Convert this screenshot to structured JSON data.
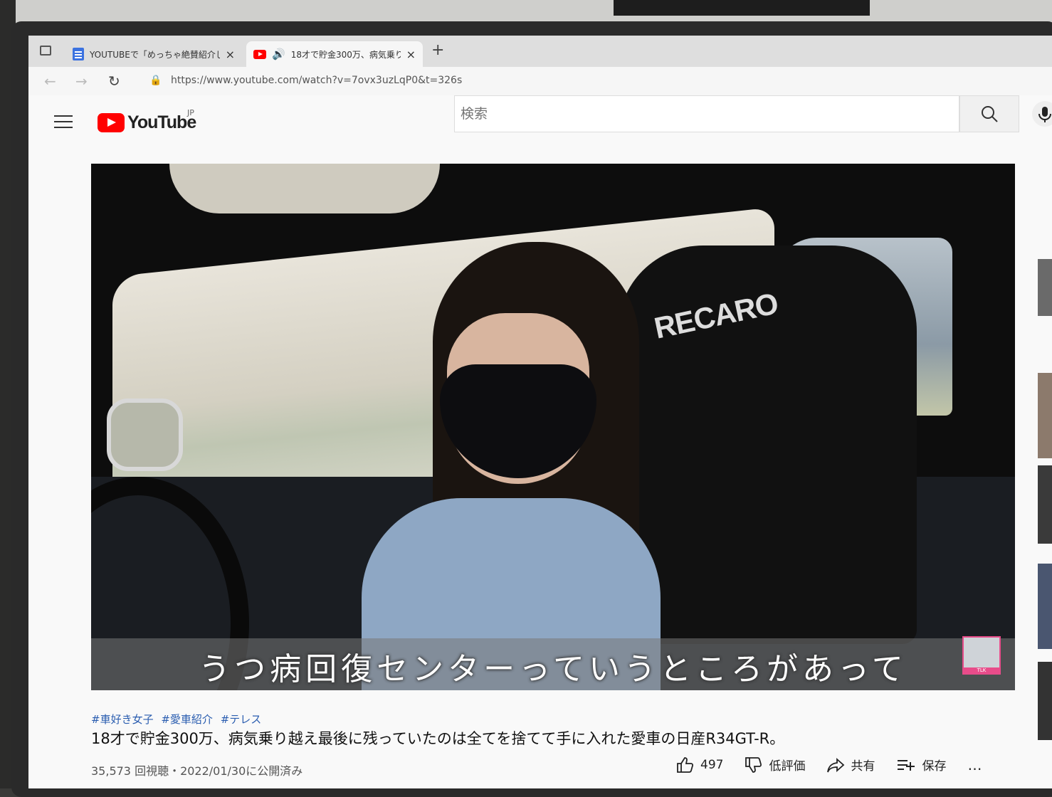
{
  "browser": {
    "tabs": [
      {
        "title": "YOUTUBEで「めっちゃ絶賛紹介して",
        "icon": "document-icon",
        "close": "×"
      },
      {
        "title": "18才で貯金300万、病気乗り",
        "icon": "youtube-favicon",
        "audio_icon": "🔊",
        "close": "×"
      }
    ],
    "new_tab": "+",
    "nav": {
      "back": "←",
      "forward": "→",
      "reload": "↻",
      "lock": "🔒"
    },
    "url": "https://www.youtube.com/watch?v=7ovx3uzLqP0&t=326s"
  },
  "youtube": {
    "logo_text": "YouTube",
    "country": "JP",
    "search_placeholder": "検索"
  },
  "video": {
    "seat_brand": "RECARO",
    "subtitle": "うつ病回復センターっていうところがあって",
    "channel_badge_text": "TLK"
  },
  "meta": {
    "hashtags": [
      "#車好き女子",
      "#愛車紹介",
      "#テレス"
    ],
    "title": "18才で貯金300万、病気乗り越え最後に残っていたのは全てを捨てて手に入れた愛車の日産R34GT-R。",
    "stats": "35,573 回視聴・2022/01/30に公開済み",
    "like_count": "497",
    "dislike_label": "低評価",
    "share_label": "共有",
    "save_label": "保存",
    "more": "…"
  },
  "colors": {
    "youtube_red": "#ff0000",
    "hashtag_blue": "#2a5db0"
  }
}
